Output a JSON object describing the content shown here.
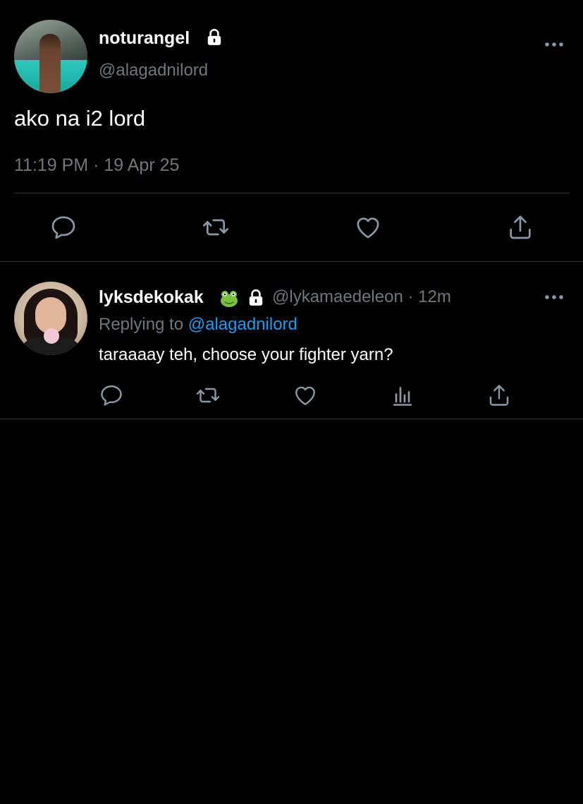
{
  "main_tweet": {
    "display_name": "noturangel",
    "handle": "@alagadnilord",
    "text": "ako na i2 lord",
    "timestamp": "11:19 PM · 19 Apr 25",
    "locked": true
  },
  "reply": {
    "display_name": "lyksdekokak",
    "emoji": "frog",
    "locked": true,
    "handle_and_time": "@lykamaedeleon · 12m",
    "replying_prefix": "Replying to",
    "replying_mention": "@alagadnilord",
    "text": "taraaaay teh, choose your fighter yarn?"
  },
  "icons": {
    "more": "more-horizontal-icon",
    "reply": "reply-icon",
    "retweet": "retweet-icon",
    "like": "heart-icon",
    "share": "share-icon",
    "analytics": "analytics-icon",
    "lock": "lock-icon"
  },
  "colors": {
    "background": "#000000",
    "text_primary": "#ffffff",
    "text_secondary": "#71767b",
    "link": "#1d9bf0",
    "divider": "#2f3336"
  }
}
